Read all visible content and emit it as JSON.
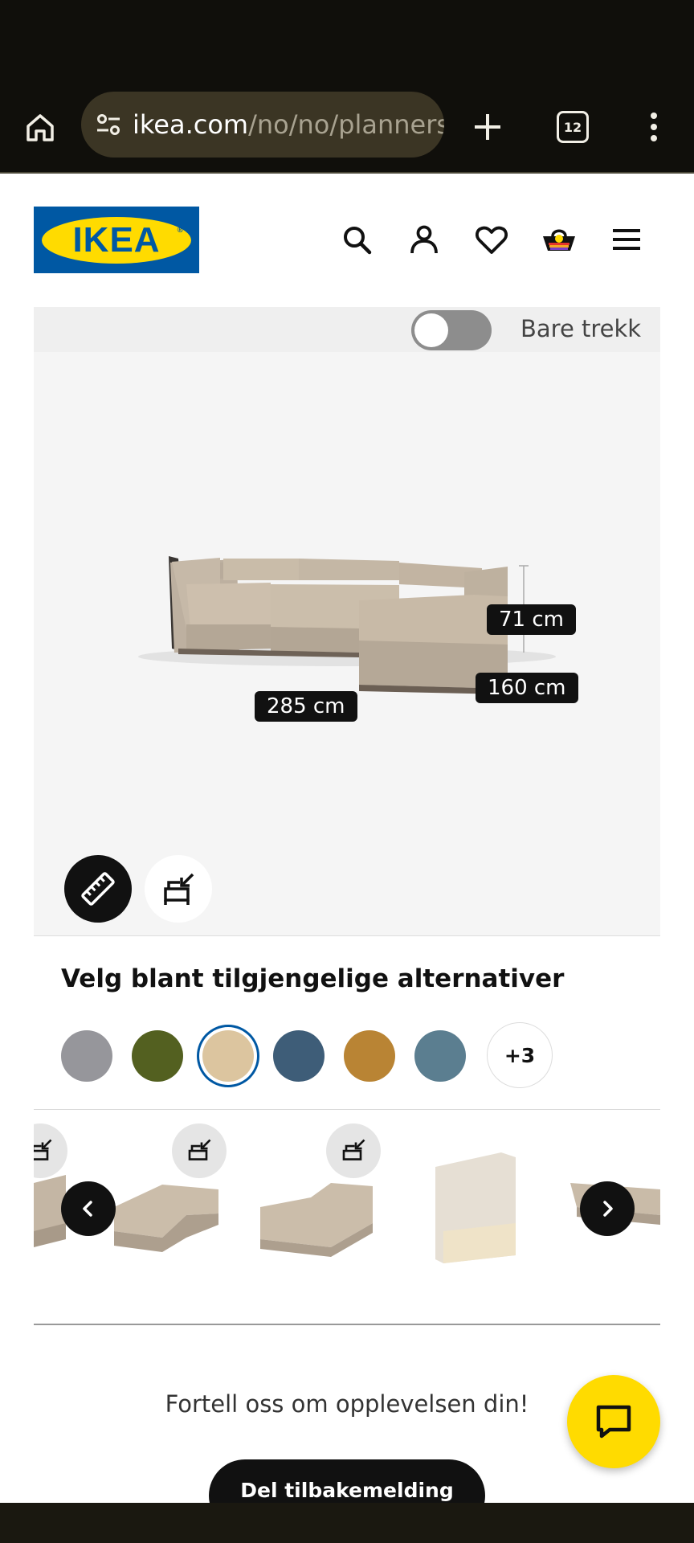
{
  "browser": {
    "url_host": "ikea.com",
    "url_path": "/no/no/planners",
    "tab_count": "12"
  },
  "brand": {
    "logo_text": "IKEA"
  },
  "viewer": {
    "toggle_label": "Bare trekk",
    "toggle_on": false,
    "dimensions": {
      "height": "71 cm",
      "depth": "160 cm",
      "width": "285 cm"
    }
  },
  "options": {
    "title": "Velg blant tilgjengelige alternativer",
    "swatches": [
      {
        "name": "grey",
        "color": "#96969b"
      },
      {
        "name": "olive-green",
        "color": "#536020"
      },
      {
        "name": "beige",
        "color": "#dcc59f",
        "selected": true
      },
      {
        "name": "dark-blue",
        "color": "#3e5d78"
      },
      {
        "name": "ochre",
        "color": "#b98434"
      },
      {
        "name": "steel-blue",
        "color": "#5b7e90"
      }
    ],
    "more_label": "+3"
  },
  "feedback": {
    "prompt": "Fortell oss om opplevelsen din!",
    "button_label": "Del tilbakemelding"
  },
  "colors": {
    "brand_blue": "#0058a3",
    "brand_yellow": "#ffdb00",
    "fabric": "#c9bba6"
  }
}
